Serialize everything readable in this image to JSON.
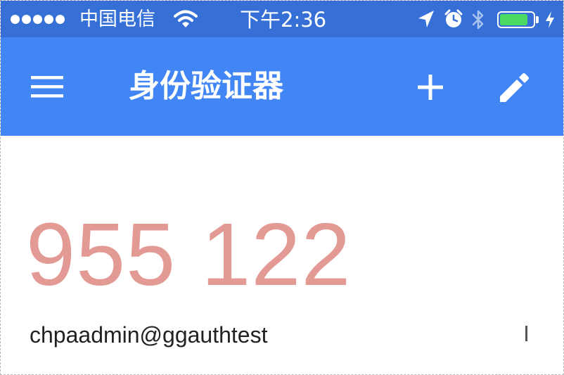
{
  "status_bar": {
    "carrier": "中国电信",
    "time": "下午2:36",
    "signal_bars": 5,
    "battery_level": 0.85,
    "battery_color": "#4cd964",
    "icons": [
      "wifi-icon",
      "location-arrow-icon",
      "alarm-icon",
      "bluetooth-icon",
      "battery-icon",
      "charging-bolt-icon"
    ]
  },
  "app_bar": {
    "title": "身份验证器",
    "background": "#4286f5",
    "icons": [
      "hamburger-menu-icon",
      "plus-icon",
      "pencil-icon"
    ]
  },
  "entry": {
    "code": "955 122",
    "account": "chpaadmin@ggauthtest",
    "code_color": "#e39a94"
  }
}
